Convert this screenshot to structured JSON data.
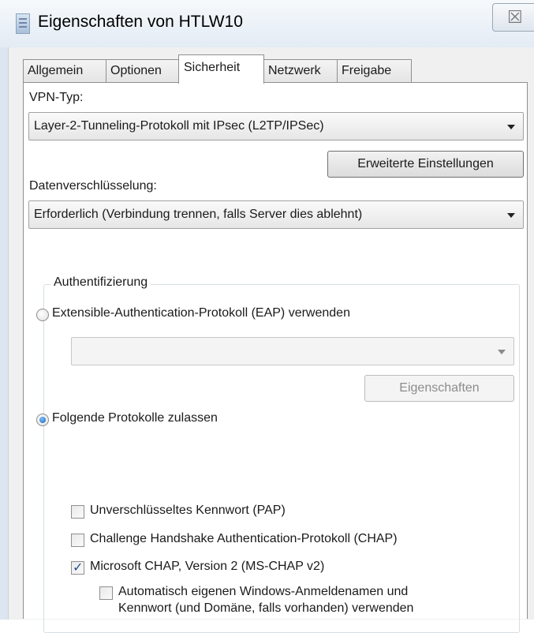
{
  "window": {
    "title": "Eigenschaften von HTLW10",
    "close_glyph": "☒"
  },
  "tabs": [
    {
      "label": "Allgemein",
      "active": false
    },
    {
      "label": "Optionen",
      "active": false
    },
    {
      "label": "Sicherheit",
      "active": true
    },
    {
      "label": "Netzwerk",
      "active": false
    },
    {
      "label": "Freigabe",
      "active": false
    }
  ],
  "security": {
    "vpn_type_label": "VPN-Typ:",
    "vpn_type_value": "Layer-2-Tunneling-Protokoll mit IPsec (L2TP/IPSec)",
    "advanced_button": "Erweiterte Einstellungen",
    "encryption_label": "Datenverschlüsselung:",
    "encryption_value": "Erforderlich (Verbindung trennen, falls Server dies ablehnt)"
  },
  "auth": {
    "group_label": "Authentifizierung",
    "eap_radio": {
      "label": "Extensible-Authentication-Protokoll (EAP) verwenden",
      "checked": false
    },
    "eap_select_value": "",
    "eap_properties_button": "Eigenschaften",
    "protocols_radio": {
      "label": "Folgende Protokolle zulassen",
      "checked": true
    },
    "protocols": [
      {
        "label": "Unverschlüsseltes Kennwort (PAP)",
        "checked": false
      },
      {
        "label": "Challenge Handshake Authentication-Protokoll (CHAP)",
        "checked": false
      },
      {
        "label": "Microsoft CHAP, Version 2 (MS-CHAP v2)",
        "checked": true
      }
    ],
    "auto_login": {
      "line1": "Automatisch eigenen Windows-Anmeldenamen und",
      "line2": "Kennwort (und Domäne, falls vorhanden) verwenden",
      "checked": false
    }
  }
}
